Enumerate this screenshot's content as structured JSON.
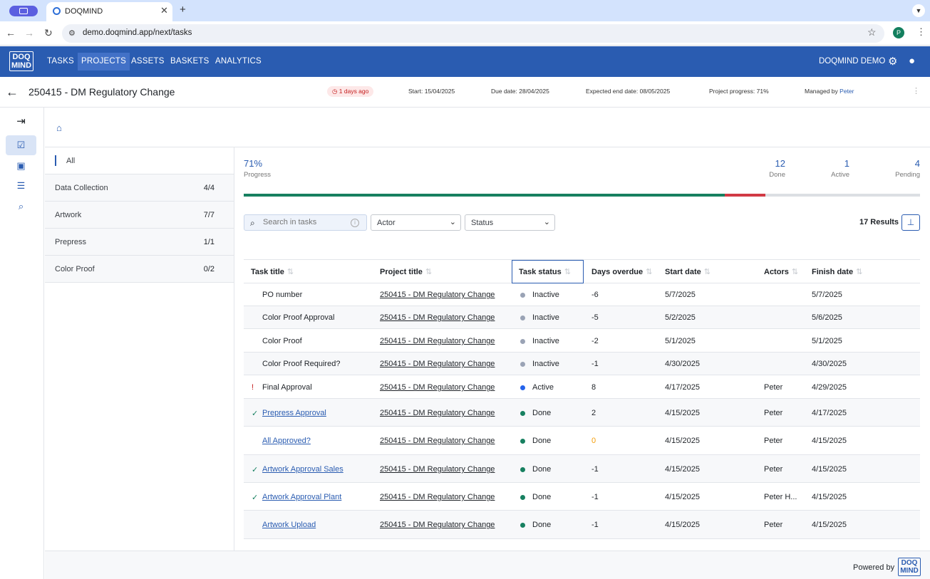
{
  "browser": {
    "tab_title": "DOQMIND",
    "url": "demo.doqmind.app/next/tasks",
    "profile_initial": "P"
  },
  "appbar": {
    "logo_line1": "DOQ",
    "logo_line2": "MIND",
    "menu": [
      "TASKS",
      "PROJECTS",
      "ASSETS",
      "BASKETS",
      "ANALYTICS"
    ],
    "active_menu": "PROJECTS",
    "account": "DOQMIND DEMO"
  },
  "project": {
    "title": "250415 - DM Regulatory Change",
    "overdue": "1 days ago",
    "start_label": "Start:",
    "start": "15/04/2025",
    "due_label": "Due date:",
    "due": "28/04/2025",
    "expected_label": "Expected end date:",
    "expected": "08/05/2025",
    "progress_label": "Project progress:",
    "progress": "71%",
    "managed_label": "Managed by",
    "manager": "Peter"
  },
  "phases": [
    {
      "name": "All",
      "count": ""
    },
    {
      "name": "Data Collection",
      "count": "4/4"
    },
    {
      "name": "Artwork",
      "count": "7/7"
    },
    {
      "name": "Prepress",
      "count": "1/1"
    },
    {
      "name": "Color Proof",
      "count": "0/2"
    }
  ],
  "stats": {
    "progress_value": "71%",
    "progress_label": "Progress",
    "done_value": "12",
    "done_label": "Done",
    "active_value": "1",
    "active_label": "Active",
    "pending_value": "4",
    "pending_label": "Pending"
  },
  "progress_bar": {
    "done_fraction": 0.711,
    "active_fraction": 0.06
  },
  "filters": {
    "search_placeholder": "Search in tasks",
    "actor": "Actor",
    "status": "Status",
    "results": "17 Results"
  },
  "table": {
    "headers": [
      "Task title",
      "Project title",
      "Task status",
      "Days overdue",
      "Start date",
      "Actors",
      "Finish date"
    ],
    "rows": [
      {
        "icon": "",
        "title": "PO number",
        "link": false,
        "project": "250415 - DM Regulatory Change",
        "status": "Inactive",
        "days": "-6",
        "start": "5/7/2025",
        "actor": "",
        "finish": "5/7/2025"
      },
      {
        "icon": "",
        "title": "Color Proof Approval",
        "link": false,
        "project": "250415 - DM Regulatory Change",
        "status": "Inactive",
        "days": "-5",
        "start": "5/2/2025",
        "actor": "",
        "finish": "5/6/2025"
      },
      {
        "icon": "",
        "title": "Color Proof",
        "link": false,
        "project": "250415 - DM Regulatory Change",
        "status": "Inactive",
        "days": "-2",
        "start": "5/1/2025",
        "actor": "",
        "finish": "5/1/2025"
      },
      {
        "icon": "",
        "title": "Color Proof Required?",
        "link": false,
        "project": "250415 - DM Regulatory Change",
        "status": "Inactive",
        "days": "-1",
        "start": "4/30/2025",
        "actor": "",
        "finish": "4/30/2025"
      },
      {
        "icon": "!",
        "title": "Final Approval",
        "link": false,
        "project": "250415 - DM Regulatory Change",
        "status": "Active",
        "days": "8",
        "start": "4/17/2025",
        "actor": "Peter",
        "finish": "4/29/2025"
      },
      {
        "icon": "✓",
        "title": "Prepress Approval",
        "link": true,
        "project": "250415 - DM Regulatory Change",
        "status": "Done",
        "days": "2",
        "start": "4/15/2025",
        "actor": "Peter",
        "finish": "4/17/2025"
      },
      {
        "icon": "",
        "title": "All Approved?",
        "link": true,
        "project": "250415 - DM Regulatory Change",
        "status": "Done",
        "days": "0",
        "start": "4/15/2025",
        "actor": "Peter",
        "finish": "4/15/2025"
      },
      {
        "icon": "✓",
        "title": "Artwork Approval Sales",
        "link": true,
        "project": "250415 - DM Regulatory Change",
        "status": "Done",
        "days": "-1",
        "start": "4/15/2025",
        "actor": "Peter",
        "finish": "4/15/2025"
      },
      {
        "icon": "✓",
        "title": "Artwork Approval Plant",
        "link": true,
        "project": "250415 - DM Regulatory Change",
        "status": "Done",
        "days": "-1",
        "start": "4/15/2025",
        "actor": "Peter H...",
        "finish": "4/15/2025"
      },
      {
        "icon": "",
        "title": "Artwork Upload",
        "link": true,
        "project": "250415 - DM Regulatory Change",
        "status": "Done",
        "days": "-1",
        "start": "4/15/2025",
        "actor": "Peter",
        "finish": "4/15/2025"
      }
    ]
  },
  "colors": {
    "brand": "#2a5cb1",
    "done": "#178060",
    "active": "#2563eb",
    "inactive": "#9aa3b5",
    "overdue_red": "#d13a44",
    "zero_orange": "#f59e0b"
  },
  "footer": {
    "powered": "Powered by"
  }
}
